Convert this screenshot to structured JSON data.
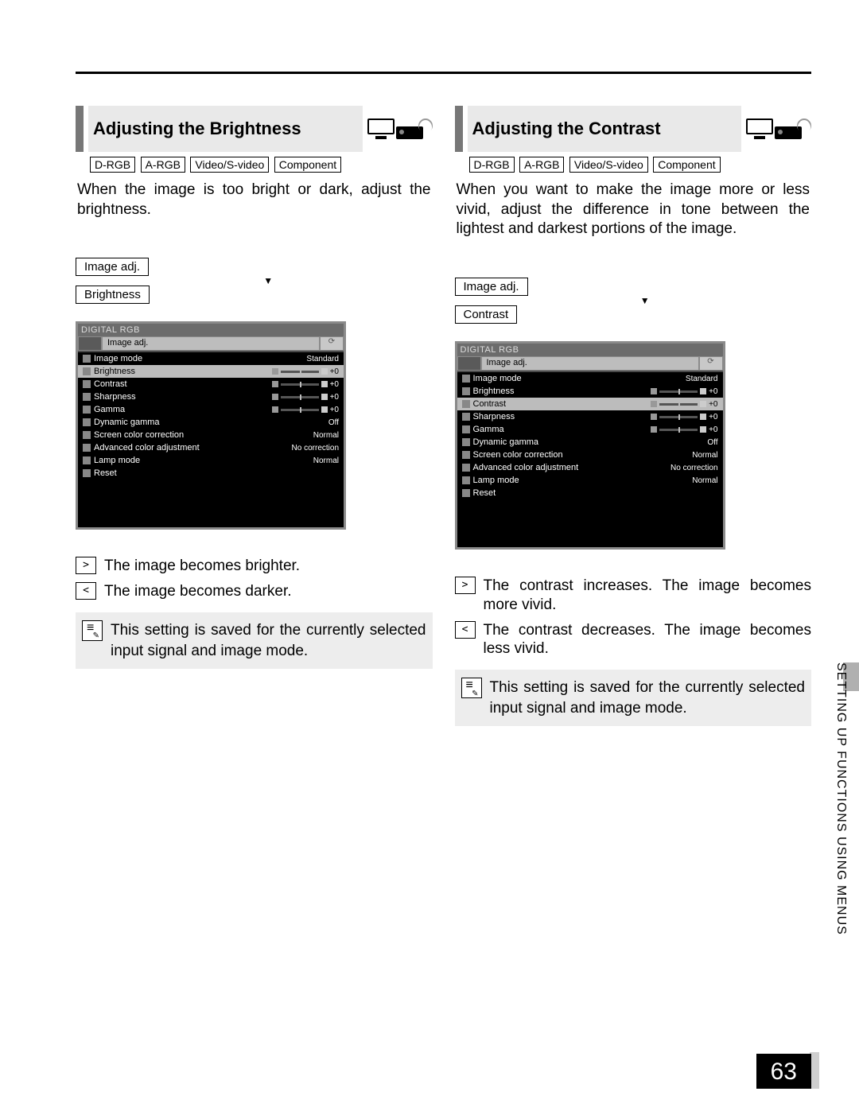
{
  "page_number": "63",
  "side_label": "SETTING UP FUNCTIONS USING MENUS",
  "tags": [
    "D-RGB",
    "A-RGB",
    "Video/S-video",
    "Component"
  ],
  "left": {
    "title": "Adjusting the Brightness",
    "body": "When the image is too bright or dark, adjust the brightness.",
    "crumb1": "Image adj.",
    "crumb2": "Brightness",
    "kv_gt": "The image becomes brighter.",
    "kv_lt": "The image becomes darker.",
    "note": "This setting is saved for the currently selected input signal and image mode.",
    "osd": {
      "header": "DIGITAL RGB",
      "tab": "Image adj.",
      "highlight_index": 1,
      "rows": [
        {
          "label": "Image mode",
          "value": "Standard",
          "slider": false
        },
        {
          "label": "Brightness",
          "value": "+0",
          "slider": true
        },
        {
          "label": "Contrast",
          "value": "+0",
          "slider": true
        },
        {
          "label": "Sharpness",
          "value": "+0",
          "slider": true
        },
        {
          "label": "Gamma",
          "value": "+0",
          "slider": true
        },
        {
          "label": "Dynamic gamma",
          "value": "Off",
          "slider": false
        },
        {
          "label": "Screen color correction",
          "value": "Normal",
          "slider": false
        },
        {
          "label": "Advanced color adjustment",
          "value": "No correction",
          "slider": false
        },
        {
          "label": "Lamp mode",
          "value": "Normal",
          "slider": false
        },
        {
          "label": "Reset",
          "value": "",
          "slider": false
        }
      ]
    }
  },
  "right": {
    "title": "Adjusting the Contrast",
    "body": "When you want to make the image more or less vivid, adjust the difference in tone between the lightest and darkest portions of the image.",
    "crumb1": "Image adj.",
    "crumb2": "Contrast",
    "kv_gt": "The contrast increases. The image becomes more vivid.",
    "kv_lt": "The contrast decreases. The image becomes less vivid.",
    "note": "This setting is saved for the currently selected input signal and image mode.",
    "osd": {
      "header": "DIGITAL RGB",
      "tab": "Image adj.",
      "highlight_index": 2,
      "rows": [
        {
          "label": "Image mode",
          "value": "Standard",
          "slider": false
        },
        {
          "label": "Brightness",
          "value": "+0",
          "slider": true
        },
        {
          "label": "Contrast",
          "value": "+0",
          "slider": true
        },
        {
          "label": "Sharpness",
          "value": "+0",
          "slider": true
        },
        {
          "label": "Gamma",
          "value": "+0",
          "slider": true
        },
        {
          "label": "Dynamic gamma",
          "value": "Off",
          "slider": false
        },
        {
          "label": "Screen color correction",
          "value": "Normal",
          "slider": false
        },
        {
          "label": "Advanced color adjustment",
          "value": "No correction",
          "slider": false
        },
        {
          "label": "Lamp mode",
          "value": "Normal",
          "slider": false
        },
        {
          "label": "Reset",
          "value": "",
          "slider": false
        }
      ]
    }
  },
  "keys": {
    "gt": ">",
    "lt": "<"
  }
}
